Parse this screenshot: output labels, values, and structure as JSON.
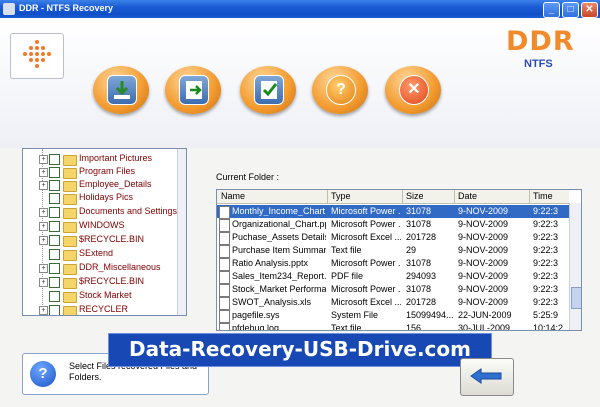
{
  "window": {
    "title": "DDR - NTFS Recovery",
    "min": "_",
    "max": "□",
    "close": "✕"
  },
  "brand": {
    "title": "DDR",
    "subtitle": "NTFS"
  },
  "toolbar": [
    {
      "name": "save-data-icon"
    },
    {
      "name": "recover-partition-icon"
    },
    {
      "name": "checklist-icon"
    },
    {
      "name": "help-icon",
      "glyph": "?"
    },
    {
      "name": "exit-icon",
      "glyph": "✕"
    }
  ],
  "tree": {
    "items": [
      {
        "label": "Important Pictures",
        "expand": "+"
      },
      {
        "label": "Program Files",
        "expand": "+"
      },
      {
        "label": "Employee_Details",
        "expand": "+"
      },
      {
        "label": "Holidays Pics",
        "expand": ""
      },
      {
        "label": "Documents and Settings",
        "expand": "+"
      },
      {
        "label": "WINDOWS",
        "expand": "+"
      },
      {
        "label": "$RECYCLE.BIN",
        "expand": "+"
      },
      {
        "label": "SExtend",
        "expand": ""
      },
      {
        "label": "DDR_Miscellaneous",
        "expand": "+"
      },
      {
        "label": "$RECYCLE.BIN",
        "expand": "+"
      },
      {
        "label": "Stock Market",
        "expand": ""
      },
      {
        "label": "RECYCLER",
        "expand": "+"
      }
    ]
  },
  "files": {
    "current_folder_label": "Current Folder :",
    "columns": [
      "Name",
      "Type",
      "Size",
      "Date",
      "Time"
    ],
    "rows": [
      [
        "Monthly_Income_Chart...",
        "Microsoft Power ...",
        "31078",
        "9-NOV-2009",
        "9:22:3"
      ],
      [
        "Organizational_Chart.pptx",
        "Microsoft Power ...",
        "31078",
        "9-NOV-2009",
        "9:22:3"
      ],
      [
        "Puchase_Assets Details...",
        "Microsoft Excel ...",
        "201728",
        "9-NOV-2009",
        "9:22:3"
      ],
      [
        "Purchase Item Summary...",
        "Text file",
        "29",
        "9-NOV-2009",
        "9:22:3"
      ],
      [
        "Ratio Analysis.pptx",
        "Microsoft Power ...",
        "31078",
        "9-NOV-2009",
        "9:22:3"
      ],
      [
        "Sales_Item234_Report...",
        "PDF file",
        "294093",
        "9-NOV-2009",
        "9:22:3"
      ],
      [
        "Stock_Market Performa...",
        "Microsoft Power ...",
        "31078",
        "9-NOV-2009",
        "9:22:3"
      ],
      [
        "SWOT_Analysis.xls",
        "Microsoft Excel ...",
        "201728",
        "9-NOV-2009",
        "9:22:3"
      ],
      [
        "pagefile.sys",
        "System File",
        "15099494...",
        "22-JUN-2009",
        "5:25:9"
      ],
      [
        "pfdebug.log",
        "Text file",
        "156",
        "30-JUL-2009",
        "10:14:2"
      ]
    ]
  },
  "info": {
    "icon": "?",
    "text": "Select Files recovered Files and Folders."
  },
  "banner": {
    "text": "Data-Recovery-USB-Drive.com"
  }
}
